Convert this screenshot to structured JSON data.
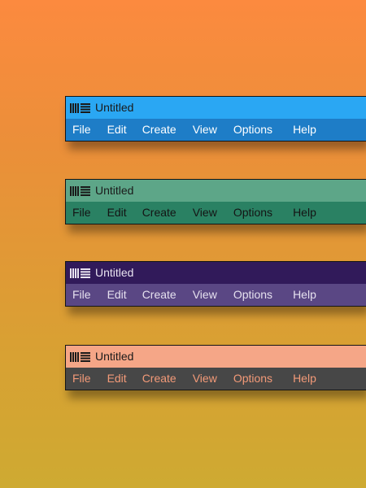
{
  "windows": [
    {
      "title": "Untitled",
      "menu": [
        "File",
        "Edit",
        "Create",
        "View",
        "Options",
        "Help"
      ],
      "colors": {
        "titlebar": "#2aa7f3",
        "title_text": "#1a1a1a",
        "menubar": "#1e7dc7",
        "menu_text": "#ffffff",
        "logo": "#1a1a1a"
      }
    },
    {
      "title": "Untitled",
      "menu": [
        "File",
        "Edit",
        "Create",
        "View",
        "Options",
        "Help"
      ],
      "colors": {
        "titlebar": "#5da688",
        "title_text": "#1a1a1a",
        "menubar": "#2a8163",
        "menu_text": "#141414",
        "logo": "#1a1a1a"
      }
    },
    {
      "title": "Untitled",
      "menu": [
        "File",
        "Edit",
        "Create",
        "View",
        "Options",
        "Help"
      ],
      "colors": {
        "titlebar": "#311a5a",
        "title_text": "#e9e4f1",
        "menubar": "#5a4784",
        "menu_text": "#e6e1ef",
        "logo": "#e9e4f1"
      }
    },
    {
      "title": "Untitled",
      "menu": [
        "File",
        "Edit",
        "Create",
        "View",
        "Options",
        "Help"
      ],
      "colors": {
        "titlebar": "#f5a687",
        "title_text": "#1a1a1a",
        "menubar": "#474747",
        "menu_text": "#f39a78",
        "logo": "#1a1a1a"
      }
    }
  ],
  "icons": {
    "app_logo": "ableton-logo-icon"
  }
}
